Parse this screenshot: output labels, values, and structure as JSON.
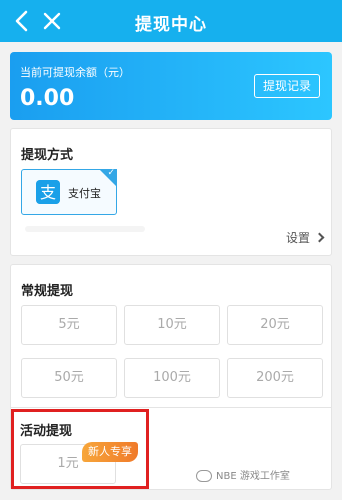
{
  "topbar": {
    "title": "提现中心",
    "back_icon": "chevron-left-icon",
    "close_icon": "close-icon",
    "background_color": "#16b0ee"
  },
  "balance": {
    "label": "当前可提现余额（元）",
    "amount": "0.00",
    "record_button": "提现记录"
  },
  "method": {
    "title": "提现方式",
    "options": [
      {
        "name": "支付宝",
        "icon": "alipay-icon",
        "selected": true
      }
    ],
    "settings_label": "设置"
  },
  "regular": {
    "title": "常规提现",
    "amounts": [
      "5元",
      "10元",
      "20元",
      "50元",
      "100元",
      "200元"
    ]
  },
  "activity": {
    "title": "活动提现",
    "amount": "1元",
    "badge": "新人专享"
  },
  "watermark": {
    "text": "NBE 游戏工作室"
  },
  "colors": {
    "accent": "#16b0ee",
    "badge": "#f38a2e",
    "highlight": "#e02020"
  }
}
